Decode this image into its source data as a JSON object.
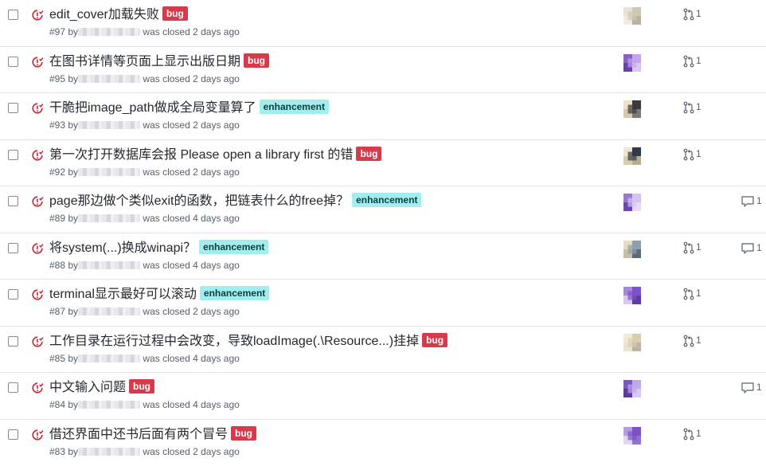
{
  "colors": {
    "closed_icon": "#cb2431",
    "bug_label": "#d73a4a",
    "enhancement_label": "#a2eeef"
  },
  "issues": [
    {
      "title": "edit_cover加载失败",
      "label": "bug",
      "number": "#97",
      "by": "by",
      "status": "was closed 2 days ago",
      "avatar": [
        "#e8e3d6",
        "#cfc8b5",
        "#f0ece3",
        "#b9b2a0"
      ],
      "pr": "1",
      "comments": ""
    },
    {
      "title": "在图书详情等页面上显示出版日期",
      "label": "bug",
      "number": "#95",
      "by": "by",
      "status": "was closed 2 days ago",
      "avatar": [
        "#8b5fc7",
        "#c4a6ea",
        "#6a3fb0",
        "#d9c6f2"
      ],
      "pr": "1",
      "comments": ""
    },
    {
      "title": "干脆把image_path做成全局变量算了",
      "label": "enhancement",
      "number": "#93",
      "by": "by",
      "status": "was closed 2 days ago",
      "avatar": [
        "#f0e2c8",
        "#3b3b3b",
        "#d8c9a8",
        "#7a7a7a"
      ],
      "pr": "1",
      "comments": ""
    },
    {
      "title": "第一次打开数据库会报 Please open a library first 的错",
      "label": "bug",
      "number": "#92",
      "by": "by",
      "status": "was closed 2 days ago",
      "avatar": [
        "#f1e6cd",
        "#2f3a44",
        "#d9ccae",
        "#b7ae96"
      ],
      "pr": "1",
      "comments": ""
    },
    {
      "title": "page那边做个类似exit的函数，把链表什么的free掉？",
      "label": "enhancement",
      "number": "#89",
      "by": "by",
      "status": "was closed 4 days ago",
      "avatar": [
        "#9a77d6",
        "#d5c4f0",
        "#6b46b5",
        "#e6dbf6"
      ],
      "pr": "",
      "comments": "1"
    },
    {
      "title": "将system(...)换成winapi？",
      "label": "enhancement",
      "number": "#88",
      "by": "by",
      "status": "was closed 4 days ago",
      "avatar": [
        "#e7dcc4",
        "#8fa0a8",
        "#c9bea6",
        "#5d6c74"
      ],
      "pr": "1",
      "comments": "1"
    },
    {
      "title": "terminal显示最好可以滚动",
      "label": "enhancement",
      "number": "#87",
      "by": "by",
      "status": "was closed 2 days ago",
      "avatar": [
        "#a888de",
        "#7a53c4",
        "#d8c9f2",
        "#5e3aa6"
      ],
      "pr": "1",
      "comments": ""
    },
    {
      "title": "工作目录在运行过程中会改变，导致loadImage(.\\Resource...)挂掉",
      "label": "bug",
      "number": "#85",
      "by": "by",
      "status": "was closed 4 days ago",
      "avatar": [
        "#f3ead6",
        "#d8cdb3",
        "#ebe3cf",
        "#bfb59c"
      ],
      "pr": "1",
      "comments": ""
    },
    {
      "title": "中文输入问题",
      "label": "bug",
      "number": "#84",
      "by": "by",
      "status": "was closed 4 days ago",
      "avatar": [
        "#7d55c6",
        "#c1a8ea",
        "#5e3aa6",
        "#d9c9f3"
      ],
      "pr": "",
      "comments": "1"
    },
    {
      "title": "借还界面中还书后面有两个冒号",
      "label": "bug",
      "number": "#83",
      "by": "by",
      "status": "was closed 2 days ago",
      "avatar": [
        "#b59ce6",
        "#7a53c4",
        "#e2d6f6",
        "#9270d3"
      ],
      "pr": "1",
      "comments": ""
    }
  ]
}
